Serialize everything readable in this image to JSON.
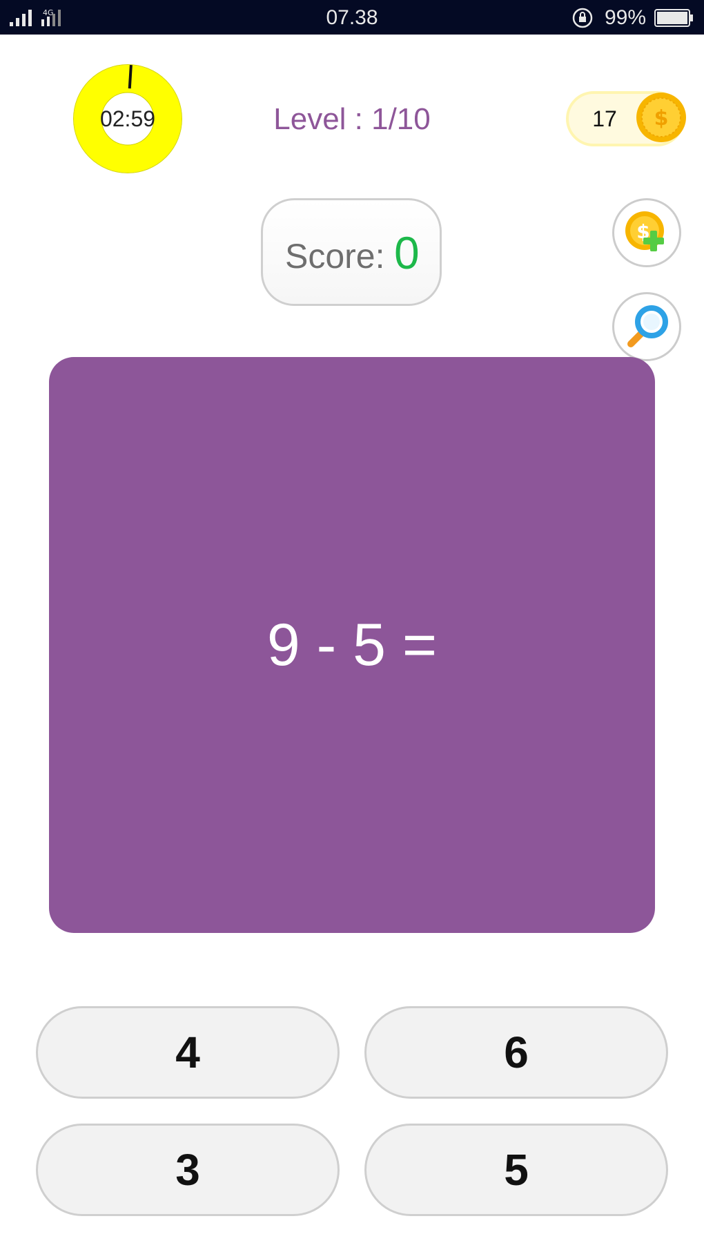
{
  "status_bar": {
    "time": "07.38",
    "network": "4G",
    "battery_percent": "99%",
    "icons": [
      "signal-icon",
      "rotation-lock-icon",
      "battery-icon"
    ]
  },
  "game": {
    "timer": "02:59",
    "timer_remaining_fraction": 0.99,
    "level": "Level : 1/10",
    "coins": "17",
    "score_label": "Score:",
    "score_value": "0",
    "question": "9 - 5 =",
    "answers": [
      "4",
      "6",
      "3",
      "5"
    ]
  },
  "colors": {
    "accent_purple": "#8d5699",
    "timer_yellow": "#ffff00",
    "score_green": "#1db84a",
    "coin_gold": "#f7b500"
  },
  "icons": {
    "add_coins": "coin-plus-icon",
    "hint": "magnifier-icon",
    "coin": "coin-icon"
  }
}
